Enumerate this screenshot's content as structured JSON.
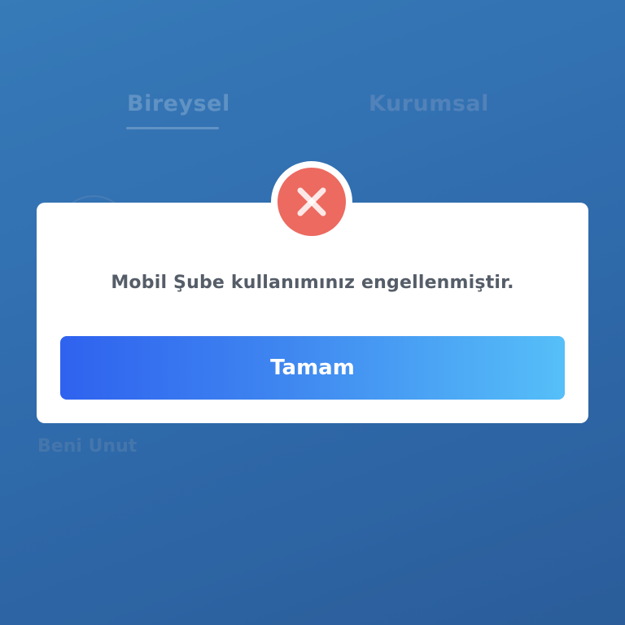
{
  "tabs": [
    {
      "label": "Bireysel",
      "active": true
    },
    {
      "label": "Kurumsal",
      "active": false
    }
  ],
  "login": {
    "forget_me_label": "Beni Unut"
  },
  "dialog": {
    "icon": "error-x-icon",
    "message": "Mobil Şube kullanımınız engellenmiştir.",
    "ok_label": "Tamam"
  },
  "colors": {
    "background": "#3574b8",
    "error": "#ec6a60",
    "button_gradient_start": "#2f62ef",
    "button_gradient_end": "#56bff8",
    "message_text": "#555d68"
  }
}
